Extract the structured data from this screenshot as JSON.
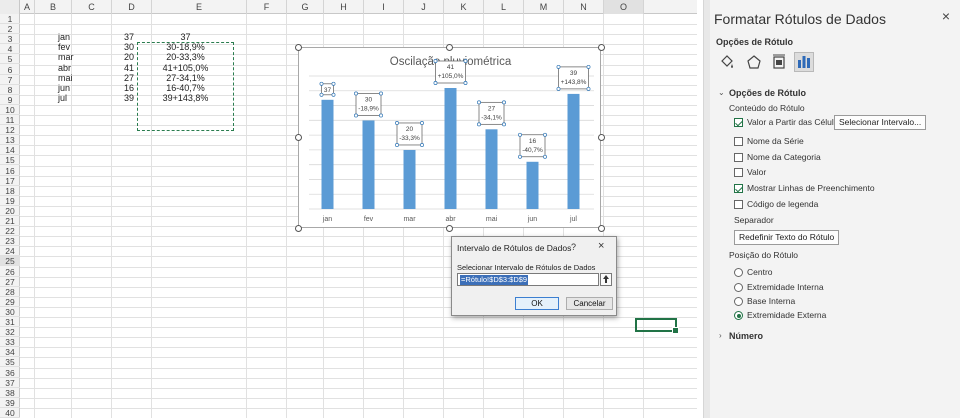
{
  "sheet": {
    "columns": [
      "A",
      "B",
      "C",
      "D",
      "E",
      "F",
      "G",
      "H",
      "I",
      "J",
      "K",
      "L",
      "M",
      "N",
      "O"
    ],
    "rows": [
      "1",
      "2",
      "3",
      "4",
      "5",
      "6",
      "7",
      "8",
      "9",
      "10",
      "11",
      "12",
      "13",
      "14",
      "15",
      "16",
      "17",
      "18",
      "19",
      "20",
      "21",
      "22",
      "23",
      "24",
      "25",
      "26",
      "27",
      "28",
      "29",
      "30",
      "31",
      "32",
      "33",
      "34",
      "35",
      "36",
      "37",
      "38",
      "39",
      "40"
    ],
    "selected_row": "25",
    "selected_column": "O",
    "data": [
      {
        "month": "jan",
        "value": "37",
        "label": "37"
      },
      {
        "month": "fev",
        "value": "30",
        "label": "30-18,9%"
      },
      {
        "month": "mar",
        "value": "20",
        "label": "20-33,3%"
      },
      {
        "month": "abr",
        "value": "41",
        "label": "41+105,0%"
      },
      {
        "month": "mai",
        "value": "27",
        "label": "27-34,1%"
      },
      {
        "month": "jun",
        "value": "16",
        "label": "16-40,7%"
      },
      {
        "month": "jul",
        "value": "39",
        "label": "39+143,8%"
      }
    ]
  },
  "chart_data": {
    "type": "bar",
    "title": "Oscilação pluviométrica",
    "categories": [
      "jan",
      "fev",
      "mar",
      "abr",
      "mai",
      "jun",
      "jul"
    ],
    "values": [
      37,
      30,
      20,
      41,
      27,
      16,
      39
    ],
    "data_labels": [
      [
        "37"
      ],
      [
        "30",
        "-18,9%"
      ],
      [
        "20",
        "-33,3%"
      ],
      [
        "41",
        "+105,0%"
      ],
      [
        "27",
        "-34,1%"
      ],
      [
        "16",
        "-40,7%"
      ],
      [
        "39",
        "+143,8%"
      ]
    ],
    "bar_color": "#5b9bd5",
    "grid": true,
    "ylim": [
      0,
      45
    ]
  },
  "panel": {
    "title": "Formatar Rótulos de Dados",
    "close": "×",
    "options_header": "Opções de Rótulo",
    "tabs": [
      "fill-line-icon",
      "effects-icon",
      "size-properties-icon",
      "label-options-icon"
    ],
    "section_label_options": "Opções de Rótulo",
    "label_contains": "Conteúdo do Rótulo",
    "checkboxes": [
      {
        "label": "Valor a Partir das Células",
        "checked": true
      },
      {
        "label": "Nome da Série",
        "checked": false
      },
      {
        "label": "Nome da Categoria",
        "checked": false
      },
      {
        "label": "Valor",
        "checked": false
      },
      {
        "label": "Mostrar Linhas de Preenchimento",
        "checked": true
      },
      {
        "label": "Código de legenda",
        "checked": false
      }
    ],
    "select_range_button": "Selecionar Intervalo...",
    "separator_label": "Separador",
    "reset_label_button": "Redefinir Texto do Rótulo",
    "label_position": "Posição do Rótulo",
    "radios": [
      {
        "label": "Centro",
        "checked": false
      },
      {
        "label": "Extremidade Interna",
        "checked": false
      },
      {
        "label": "Base Interna",
        "checked": false
      },
      {
        "label": "Extremidade Externa",
        "checked": true
      }
    ],
    "section_number": "Número"
  },
  "dialog": {
    "title": "Intervalo de Rótulos de Dados",
    "help": "?",
    "close": "×",
    "prompt": "Selecionar Intervalo de Rótulos de Dados",
    "value": "=Rótulo!$D$3:$D$9",
    "ok": "OK",
    "cancel": "Cancelar"
  }
}
